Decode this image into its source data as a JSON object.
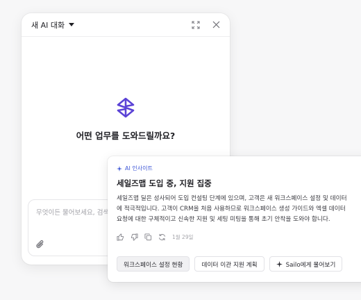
{
  "chat": {
    "title": "새 AI 대화",
    "prompt": "어떤 업무를 도와드릴까요?",
    "input_placeholder": "무엇이든 물어보세요, 검색해보세요"
  },
  "insight": {
    "badge": "AI 인사이트",
    "title": "세일즈맵 도입 중, 지원 집중",
    "body_lines": [
      "세일즈맵 딜은 성사되어 도입 컨설팅 단계에 있으며, 고객은 새 워크스페이스 설정 및 데이터",
      "에 적극적입니다. 고객이 CRM을 처음 사용하므로 워크스페이스 생성 가이드와 엑셀 데이터",
      "요청에 대한 구체적이고 신속한 지원 및 세팅 미팅을 통해 초기 안착을 도와야 합니다."
    ],
    "date": "1월 29일",
    "chips": {
      "workspace": "워크스페이스 설정 현황",
      "migration": "데이터 이관 지원 계획",
      "ask": "Sailo에게 물어보기"
    }
  },
  "colors": {
    "accent": "#3d56d6",
    "logo": "#5b43d6"
  },
  "icons": [
    "chevron-down-icon",
    "expand-icon",
    "close-icon",
    "sailo-logo-icon",
    "paperclip-icon",
    "sparkle-icon",
    "thumbs-up-icon",
    "thumbs-down-icon",
    "copy-icon",
    "refresh-icon"
  ]
}
